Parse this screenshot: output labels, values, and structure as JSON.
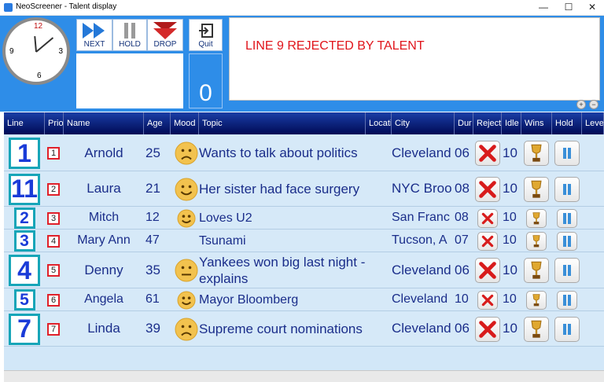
{
  "window": {
    "title": "NeoScreener - Talent display",
    "min": "—",
    "max": "☐",
    "close": "✕"
  },
  "clock": {
    "n12": "12",
    "n3": "3",
    "n6": "6",
    "n9": "9"
  },
  "toolbar": {
    "next_label": "NEXT",
    "hold_label": "HOLD",
    "drop_label": "DROP",
    "quit_label": "Quit"
  },
  "counter": "0",
  "message": "LINE 9 REJECTED BY TALENT",
  "zoom": {
    "in": "+",
    "out": "−"
  },
  "columns": [
    "Line",
    "Prio",
    "Name",
    "Age",
    "Mood",
    "Topic",
    "Location",
    "City",
    "Dur",
    "Reject",
    "Idle",
    "Wins",
    "Hold",
    "Level"
  ],
  "colors": {
    "accent": "#2e8de8",
    "header": "#0a1f7a",
    "text": "#1a2d8a",
    "message": "#e0141b",
    "reject": "#d81b1b",
    "line_border": "#17a5b8"
  },
  "rows": [
    {
      "line": "1",
      "prio": "1",
      "name": "Arnold",
      "age": "25",
      "mood": "sad",
      "topic": "Wants to talk about politics",
      "city": "Cleveland",
      "dur": "06",
      "idle": "10"
    },
    {
      "line": "11",
      "prio": "2",
      "name": "Laura",
      "age": "21",
      "mood": "happy",
      "topic": "Her sister had face surgery",
      "city": "NYC Broo",
      "dur": "08",
      "idle": "10"
    },
    {
      "line": "2",
      "prio": "3",
      "name": "Mitch",
      "age": "12",
      "mood": "happy",
      "topic": "Loves U2",
      "city": "San Franc",
      "dur": "08",
      "idle": "10"
    },
    {
      "line": "3",
      "prio": "4",
      "name": "Mary Ann",
      "age": "47",
      "mood": "",
      "topic": "Tsunami",
      "city": "Tucson, A",
      "dur": "07",
      "idle": "10"
    },
    {
      "line": "4",
      "prio": "5",
      "name": "Denny",
      "age": "35",
      "mood": "neutral",
      "topic": "Yankees won big last night - explains",
      "city": "Cleveland",
      "dur": "06",
      "idle": "10"
    },
    {
      "line": "5",
      "prio": "6",
      "name": "Angela",
      "age": "61",
      "mood": "happy",
      "topic": "Mayor Bloomberg",
      "city": "Cleveland",
      "dur": "10",
      "idle": "10"
    },
    {
      "line": "7",
      "prio": "7",
      "name": "Linda",
      "age": "39",
      "mood": "sad",
      "topic": "Supreme court nominations",
      "city": "Cleveland",
      "dur": "06",
      "idle": "10"
    }
  ]
}
